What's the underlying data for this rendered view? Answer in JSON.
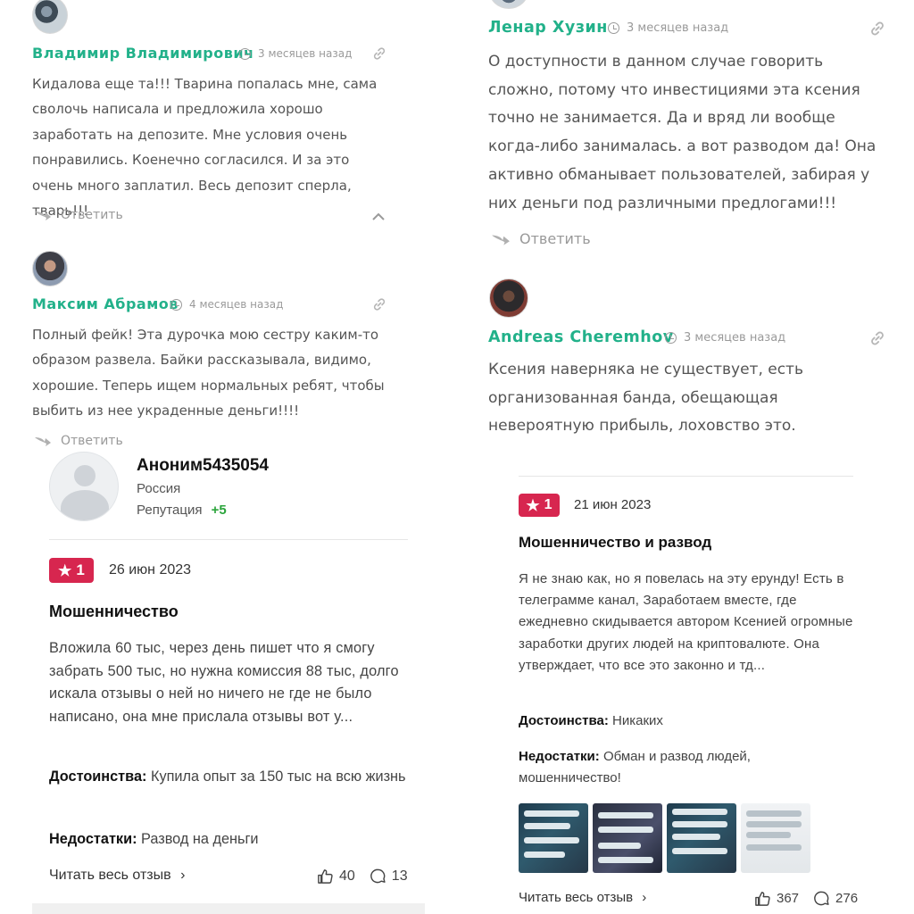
{
  "left_comments": [
    {
      "author": "Владимир Владимирович",
      "time": "3 месяцев назад",
      "text": "Кидалова еще та!!! Тварина попалась мне, сама сволочь написала и предложила хорошо заработать на депозите. Мне условия очень понравились. Коенечно согласился. И за это очень много заплатил. Весь депозит сперла, тварь!!!",
      "reply": "Ответить"
    },
    {
      "author": "Максим Абрамов",
      "time": "4 месяцев назад",
      "text": "Полный фейк! Эта дурочка мою сестру каким-то образом развела. Байки рассказывала, видимо, хорошие. Теперь ищем нормальных ребят, чтобы выбить из нее украденные деньги!!!!",
      "reply": "Ответить"
    }
  ],
  "right_comments": [
    {
      "author": "Ленар Хузин",
      "time": "3 месяцев назад",
      "text": "О доступности в данном случае говорить сложно, потому что инвестициями эта ксения точно не занимается. Да и вряд ли вообще когда-либо занималась. а вот разводом да! Она активно обманывает пользователей, забирая у них деньги под различными предлогами!!!",
      "reply": "Ответить"
    },
    {
      "author": "Andreas Cheremhov",
      "time": "3 месяцев назад",
      "text": "Ксения наверняка не существует, есть организованная банда, обещающая невероятную прибыль, лоховство это."
    }
  ],
  "review_left": {
    "user": "Аноним5435054",
    "country": "Россия",
    "reputation_label": "Репутация",
    "reputation_value": "+5",
    "rating": "1",
    "date": "26 июн 2023",
    "title": "Мошенничество",
    "body": "Вложила 60 тыс, через день пишет что я смогу забрать 500 тыс, но нужна комиссия 88 тыс, долго искала отзывы о ней но ничего не где не было написано, она мне прислала отзывы вот у...",
    "pros_label": "Достоинства:",
    "pros": "Купила опыт за 150 тыс на всю жизнь",
    "cons_label": "Недостатки:",
    "cons": "Развод на деньги",
    "read_more": "Читать весь отзыв",
    "likes": "40",
    "comments": "13"
  },
  "review_right": {
    "rating": "1",
    "date": "21 июн 2023",
    "title": "Мошенничество и развод",
    "body": "Я не знаю как, но я повелась на эту ерунду! Есть в телеграмме канал, Заработаем вместе, где ежедневно скидывается автором Ксенией огромные заработки других людей на криптовалюте. Она утверждает, что все это законно и тд...",
    "pros_label": "Достоинства:",
    "pros": "Никаких",
    "cons_label": "Недостатки:",
    "cons": "Обман и развод людей, мошенничество!",
    "read_more": "Читать весь отзыв",
    "likes": "367",
    "comments": "276"
  },
  "colors": {
    "author": "#22b18a",
    "badge": "#d7264f",
    "reputation": "#2aa43b"
  }
}
